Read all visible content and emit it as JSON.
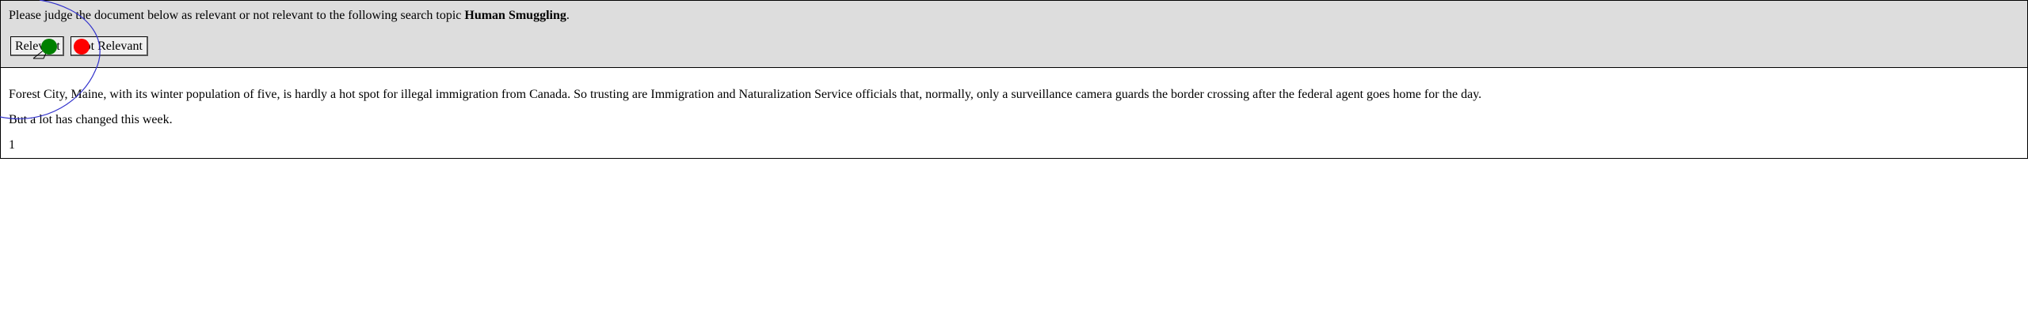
{
  "instruction": {
    "prefix": "Please judge the document below as relevant or not relevant to the following search topic ",
    "topic": "Human Smuggling",
    "suffix": "."
  },
  "buttons": {
    "relevant": "Relevant",
    "not_relevant": "Not Relevant"
  },
  "document": {
    "paragraphs": [
      "Forest City, Maine, with its winter population of five, is hardly a hot spot for illegal immigration from Canada. So trusting are Immigration and Naturalization Service officials that, normally, only a surveillance camera guards the border crossing after the federal agent goes home for the day.",
      "But a lot has changed this week.",
      "1"
    ]
  },
  "colors": {
    "header_bg": "#dddddd",
    "marker_green": "#008000",
    "marker_red": "#ff0000",
    "trace_blue": "#3333cc"
  }
}
